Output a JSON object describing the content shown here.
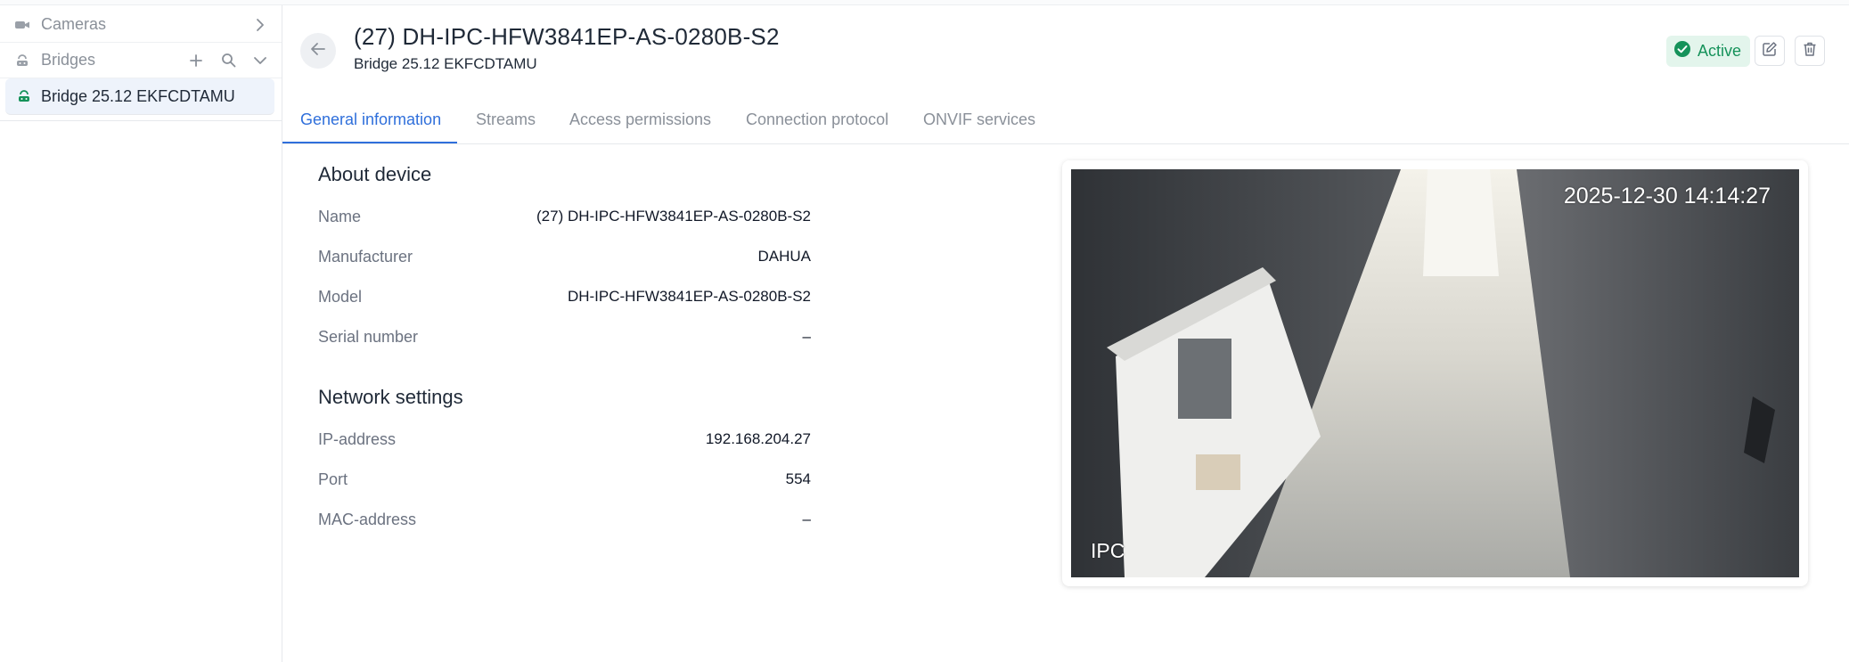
{
  "sidebar": {
    "cameras_label": "Cameras",
    "bridges_label": "Bridges",
    "bridge_items": [
      {
        "label": "Bridge 25.12 EKFCDTAMU",
        "selected": true
      }
    ],
    "icons": [
      "camera-icon",
      "chevron-right-icon",
      "bridge-icon",
      "plus-icon",
      "search-icon",
      "chevron-down-icon"
    ]
  },
  "header": {
    "title": "(27) DH-IPC-HFW3841EP-AS-0280B-S2",
    "subtitle": "Bridge 25.12 EKFCDTAMU",
    "status": "Active",
    "status_color": "#15925a",
    "icons": [
      "arrow-left-icon",
      "check-circle-icon",
      "edit-icon",
      "trash-icon"
    ]
  },
  "tabs": [
    {
      "label": "General information",
      "active": true
    },
    {
      "label": "Streams",
      "active": false
    },
    {
      "label": "Access permissions",
      "active": false
    },
    {
      "label": "Connection protocol",
      "active": false
    },
    {
      "label": "ONVIF services",
      "active": false
    }
  ],
  "accent_color": "#2f6fdb",
  "about": {
    "title": "About device",
    "fields": [
      {
        "label": "Name",
        "value": "(27) DH-IPC-HFW3841EP-AS-0280B-S2"
      },
      {
        "label": "Manufacturer",
        "value": "DAHUA"
      },
      {
        "label": "Model",
        "value": "DH-IPC-HFW3841EP-AS-0280B-S2"
      },
      {
        "label": "Serial number",
        "value": "–"
      }
    ]
  },
  "network": {
    "title": "Network settings",
    "fields": [
      {
        "label": "IP-address",
        "value": "192.168.204.27"
      },
      {
        "label": "Port",
        "value": "554"
      },
      {
        "label": "MAC-address",
        "value": "–"
      }
    ]
  },
  "preview": {
    "timestamp": "2025-12-30 14:14:27",
    "camera_name": "IPC"
  }
}
